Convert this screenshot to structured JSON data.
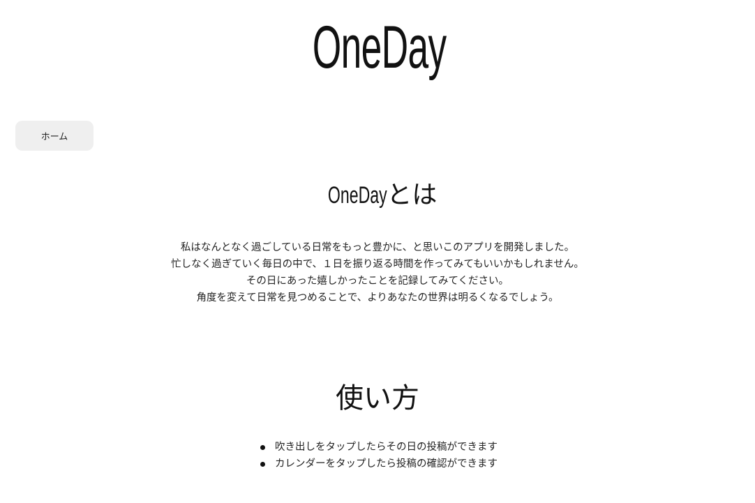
{
  "header": {
    "logo_text": "OneDay"
  },
  "nav": {
    "home_label": "ホーム"
  },
  "about": {
    "title_brand": "OneDay",
    "title_suffix": "とは",
    "lines": [
      "私はなんとなく過ごしている日常をもっと豊かに、と思いこのアプリを開発しました。",
      "忙しなく過ぎていく毎日の中で、１日を振り返る時間を作ってみてもいいかもしれません。",
      "その日にあった嬉しかったことを記録してみてください。",
      "角度を変えて日常を見つめることで、よりあなたの世界は明るくなるでしょう。"
    ]
  },
  "usage": {
    "title": "使い方",
    "items": [
      "吹き出しをタップしたらその日の投稿ができます",
      "カレンダーをタップしたら投稿の確認ができます"
    ]
  }
}
